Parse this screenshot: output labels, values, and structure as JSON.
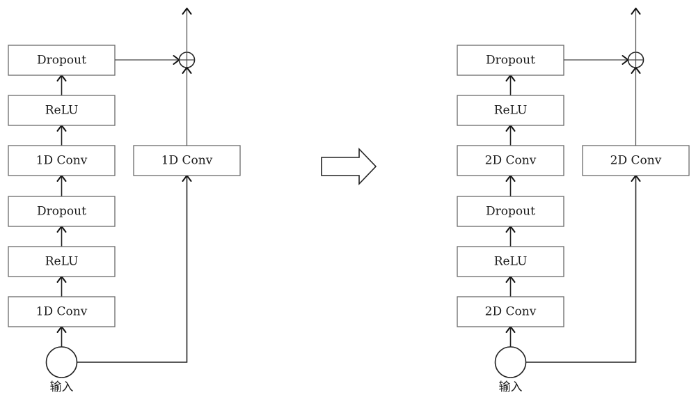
{
  "diagram": {
    "transition_arrow": "right-arrow",
    "panels": [
      {
        "id": "before",
        "main_stack": [
          "1D Conv",
          "ReLU",
          "Dropout",
          "1D Conv",
          "ReLU",
          "Dropout"
        ],
        "skip_block": "1D Conv",
        "input_label": "输入",
        "merge_symbol": "sum-circle"
      },
      {
        "id": "after",
        "main_stack": [
          "2D Conv",
          "ReLU",
          "Dropout",
          "2D Conv",
          "ReLU",
          "Dropout"
        ],
        "skip_block": "2D Conv",
        "input_label": "输入",
        "merge_symbol": "sum-circle"
      }
    ]
  }
}
